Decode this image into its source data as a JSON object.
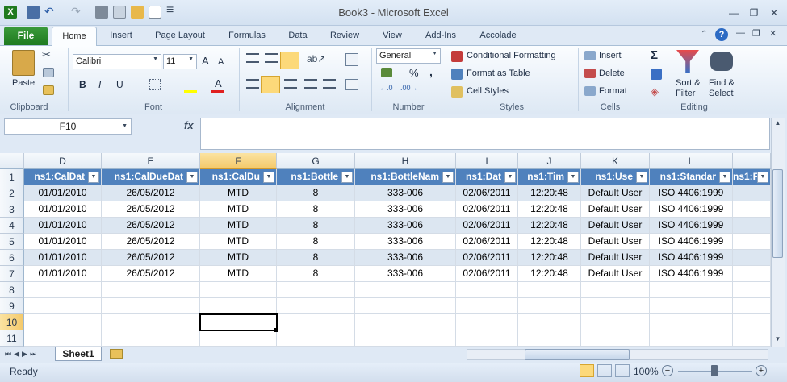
{
  "window": {
    "title": "Book3  -  Microsoft Excel"
  },
  "ribbon_tabs": [
    "File",
    "Home",
    "Insert",
    "Page Layout",
    "Formulas",
    "Data",
    "Review",
    "View",
    "Add-Ins",
    "Accolade"
  ],
  "font": {
    "name": "Calibri",
    "size": "11"
  },
  "number_format": "General",
  "labels": {
    "paste": "Paste",
    "clipboard": "Clipboard",
    "font": "Font",
    "alignment": "Alignment",
    "number": "Number",
    "styles": "Styles",
    "cells": "Cells",
    "editing": "Editing",
    "conditional_formatting": "Conditional Formatting",
    "format_as_table": "Format as Table",
    "cell_styles": "Cell Styles",
    "insert": "Insert",
    "delete": "Delete",
    "format": "Format",
    "sort_filter_1": "Sort &",
    "sort_filter_2": "Filter",
    "find_select_1": "Find &",
    "find_select_2": "Select",
    "bold": "B",
    "italic": "I",
    "underline": "U",
    "font_color": "A",
    "grow": "A",
    "shrink": "A",
    "percent": "%",
    "comma": ",",
    "sigma": "Σ",
    "fx": "fx"
  },
  "name_box": "F10",
  "columns": [
    {
      "letter": "D"
    },
    {
      "letter": "E"
    },
    {
      "letter": "F"
    },
    {
      "letter": "G"
    },
    {
      "letter": "H"
    },
    {
      "letter": "I"
    },
    {
      "letter": "J"
    },
    {
      "letter": "K"
    },
    {
      "letter": "L"
    },
    {
      "letter": ""
    }
  ],
  "rows": [
    "1",
    "2",
    "3",
    "4",
    "5",
    "6",
    "7",
    "8",
    "9",
    "10",
    "11"
  ],
  "table_headers": [
    "ns1:CalDat",
    "ns1:CalDueDat",
    "ns1:CalDu",
    "ns1:Bottle",
    "ns1:BottleNam",
    "ns1:Dat",
    "ns1:Tim",
    "ns1:Use",
    "ns1:Standar",
    "ns1:F"
  ],
  "table_rows": [
    [
      "01/01/2010",
      "26/05/2012",
      "MTD",
      "8",
      "333-006",
      "02/06/2011",
      "12:20:48",
      "Default User",
      "ISO 4406:1999",
      ""
    ],
    [
      "01/01/2010",
      "26/05/2012",
      "MTD",
      "8",
      "333-006",
      "02/06/2011",
      "12:20:48",
      "Default User",
      "ISO 4406:1999",
      ""
    ],
    [
      "01/01/2010",
      "26/05/2012",
      "MTD",
      "8",
      "333-006",
      "02/06/2011",
      "12:20:48",
      "Default User",
      "ISO 4406:1999",
      ""
    ],
    [
      "01/01/2010",
      "26/05/2012",
      "MTD",
      "8",
      "333-006",
      "02/06/2011",
      "12:20:48",
      "Default User",
      "ISO 4406:1999",
      ""
    ],
    [
      "01/01/2010",
      "26/05/2012",
      "MTD",
      "8",
      "333-006",
      "02/06/2011",
      "12:20:48",
      "Default User",
      "ISO 4406:1999",
      ""
    ],
    [
      "01/01/2010",
      "26/05/2012",
      "MTD",
      "8",
      "333-006",
      "02/06/2011",
      "12:20:48",
      "Default User",
      "ISO 4406:1999",
      ""
    ]
  ],
  "sheet_tab": "Sheet1",
  "status": {
    "ready": "Ready",
    "zoom": "100%"
  },
  "colors": {
    "table_header": "#4f81bd",
    "band": "#dce6f1",
    "file_tab": "#2a8a2a"
  }
}
